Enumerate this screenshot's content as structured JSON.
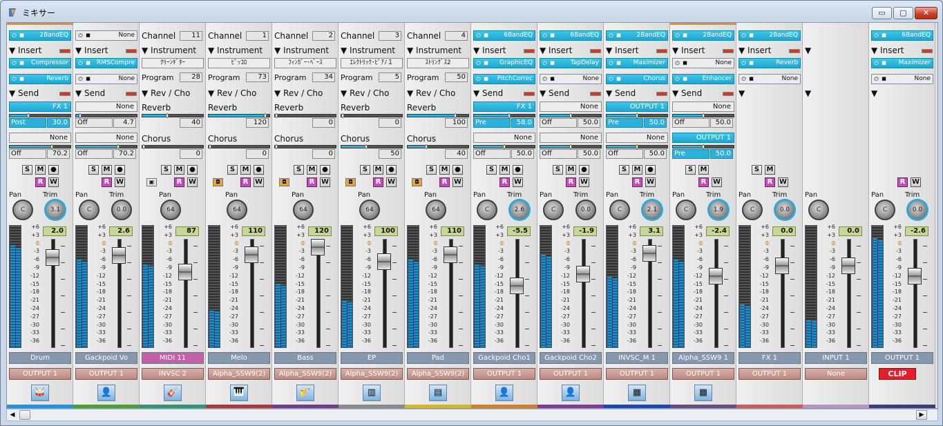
{
  "window": {
    "title": "ミキサー",
    "minimize": "▭",
    "maximize": "▢",
    "close": "✕"
  },
  "labels": {
    "insert": "Insert",
    "send": "Send",
    "channel": "Channel",
    "instrument": "Instrument",
    "program": "Program",
    "revcho": "Rev / Cho",
    "reverb": "Reverb",
    "chorus": "Chorus",
    "pan": "Pan",
    "trim": "Trim",
    "s": "S",
    "m": "M",
    "r": "R",
    "w": "W"
  },
  "scale": [
    "+6",
    "+3",
    "0",
    "-3",
    "-6",
    "-9",
    "-12",
    "-15",
    "-18",
    "-21",
    "-24",
    "-27",
    "-30",
    "-33",
    "-36"
  ],
  "scrollbar": {
    "left_arrow": "◀",
    "right_arrow": "▶"
  },
  "strips": [
    {
      "type": "audio",
      "top_color": "#e08b3a",
      "eq": "2BandEQ",
      "eq_on": true,
      "ins1": "Compressor",
      "ins1_on": true,
      "ins2": "Reverb",
      "ins2_on": true,
      "send1": "FX 1",
      "send1_on": true,
      "send1_mode": "Post",
      "send1_mode_on": true,
      "send1_val": "30.0",
      "send1_level": 0.3,
      "send2": "None",
      "send2_on": false,
      "send2_mode": "Off",
      "send2_mode_on": false,
      "send2_val": "70.2",
      "send2_level": 0.7,
      "pan": "C",
      "trim": "3.1",
      "trim_on": true,
      "level": "2.0",
      "fader": 0.82,
      "meter": 0.84,
      "name": "Drum",
      "name_color": "#8797ae",
      "output": "OUTPUT 1",
      "icon": "drums-icon",
      "glyph": "🥁",
      "color": "#2f8fd0",
      "rec": true
    },
    {
      "type": "audio",
      "top_color": "",
      "eq": "None",
      "eq_on": false,
      "ins1": "RMSCompre",
      "ins1_on": true,
      "ins2": "None",
      "ins2_on": false,
      "send1": "None",
      "send1_on": false,
      "send1_mode": "Off",
      "send1_mode_on": false,
      "send1_val": "4.7",
      "send1_level": 0.05,
      "send2": "None",
      "send2_on": false,
      "send2_mode": "Off",
      "send2_mode_on": false,
      "send2_val": "70.2",
      "send2_level": 0.7,
      "pan": "C",
      "trim": "0.0",
      "trim_on": false,
      "level": "2.6",
      "fader": 0.84,
      "meter": 0.72,
      "name": "Gackpoid Vo",
      "name_color": "#8797ae",
      "output": "OUTPUT 1",
      "icon": "vocal-icon",
      "glyph": "👤",
      "color": "#4d9c45",
      "rec": true
    },
    {
      "type": "midi",
      "channel": "11",
      "instrument": "ｸﾘｰﾝｷﾞﾀｰ",
      "program": "28",
      "reverb": "40",
      "reverb_level": 0.4,
      "chorus": "0",
      "chorus_level": 0.0,
      "pan": "64",
      "level": "87",
      "fader": 0.68,
      "meter": 0.68,
      "name": "MIDI 11",
      "name_color": "#c65fa7",
      "output": "INVSC 2",
      "icon": "guitar-icon",
      "glyph": "🎸",
      "color": "#3f8e73",
      "midi_icon": "▣"
    },
    {
      "type": "midi",
      "channel": "1",
      "instrument": "ﾋﾟｯｺﾛ",
      "program": "73",
      "reverb": "120",
      "reverb_level": 0.95,
      "chorus": "0",
      "chorus_level": 0.0,
      "pan": "64",
      "level": "110",
      "fader": 0.85,
      "meter": 0.3,
      "name": "Melo",
      "name_color": "#8797ae",
      "output": "Alpha_SSW9(2)",
      "icon": "piano-icon",
      "glyph": "🎹",
      "color": "#9f3e3e",
      "midi_icon": "◘"
    },
    {
      "type": "midi",
      "channel": "2",
      "instrument": "ﾌｨﾝｶﾞｰ･ﾍﾞｰｽ",
      "program": "34",
      "reverb": "0",
      "reverb_level": 0.0,
      "chorus": "0",
      "chorus_level": 0.0,
      "pan": "64",
      "level": "120",
      "fader": 0.92,
      "meter": 0.52,
      "name": "Bass",
      "name_color": "#8797ae",
      "output": "Alpha_SSW9(2)",
      "icon": "bass-icon",
      "glyph": "🎷",
      "color": "#6d3f88",
      "midi_icon": "◘"
    },
    {
      "type": "midi",
      "channel": "3",
      "instrument": "ｴﾚｸﾄﾘｯｸ･ﾋﾟｱﾉ１",
      "program": "5",
      "reverb": "0",
      "reverb_level": 0.0,
      "chorus": "50",
      "chorus_level": 0.4,
      "pan": "64",
      "level": "100",
      "fader": 0.78,
      "meter": 0.38,
      "name": "EP",
      "name_color": "#8797ae",
      "output": "Alpha_SSW9(2)",
      "icon": "organ-icon",
      "glyph": "▥",
      "color": "#8a8a8a",
      "midi_icon": "◘"
    },
    {
      "type": "midi",
      "channel": "4",
      "instrument": "ｽﾄﾘﾝｸﾞｽ2",
      "program": "50",
      "reverb": "100",
      "reverb_level": 0.8,
      "chorus": "40",
      "chorus_level": 0.3,
      "pan": "64",
      "level": "110",
      "fader": 0.85,
      "meter": 0.72,
      "name": "Pad",
      "name_color": "#8797ae",
      "output": "Alpha_SSW9(2)",
      "icon": "synth-icon",
      "glyph": "▤",
      "color": "#d1b43a",
      "midi_icon": "◘"
    },
    {
      "type": "audio",
      "top_color": "",
      "eq": "6BandEQ",
      "eq_on": true,
      "ins1": "GraphicEQ",
      "ins1_on": true,
      "ins2": "PitchCorrec",
      "ins2_on": true,
      "send1": "FX 1",
      "send1_on": true,
      "send1_mode": "Pre",
      "send1_mode_on": true,
      "send1_val": "58.0",
      "send1_level": 0.58,
      "send2": "None",
      "send2_on": false,
      "send2_mode": "Off",
      "send2_mode_on": false,
      "send2_val": "50.0",
      "send2_level": 0.5,
      "pan": "C",
      "trim": "2.6",
      "trim_on": true,
      "level": "-5.5",
      "fader": 0.55,
      "meter": 0.68,
      "name": "Gackpoid Cho1",
      "name_color": "#8797ae",
      "output": "OUTPUT 1",
      "icon": "vocal-red-icon",
      "glyph": "👤",
      "color": "#c78439",
      "rec": true
    },
    {
      "type": "audio",
      "top_color": "",
      "eq": "6BandEQ",
      "eq_on": true,
      "ins1": "TapDelay",
      "ins1_on": true,
      "ins2": "None",
      "ins2_on": false,
      "send1": "None",
      "send1_on": false,
      "send1_mode": "Off",
      "send1_mode_on": false,
      "send1_val": "50.0",
      "send1_level": 0.5,
      "send2": "None",
      "send2_on": false,
      "send2_mode": "Off",
      "send2_mode_on": false,
      "send2_val": "50.0",
      "send2_level": 0.5,
      "pan": "C",
      "trim": "0.0",
      "trim_on": false,
      "level": "-1.9",
      "fader": 0.66,
      "meter": 0.76,
      "name": "Gackpoid Cho2",
      "name_color": "#8797ae",
      "output": "OUTPUT 1",
      "icon": "vocal-icon",
      "glyph": "👤",
      "color": "#7a3f8f",
      "rec": true
    },
    {
      "type": "audio",
      "top_color": "",
      "eq": "2BandEQ",
      "eq_on": true,
      "ins1": "Maximizer",
      "ins1_on": true,
      "ins2": "Chorus",
      "ins2_on": true,
      "send1": "OUTPUT 1",
      "send1_on": true,
      "send1_mode": "Pre",
      "send1_mode_on": true,
      "send1_val": "50.0",
      "send1_level": 0.5,
      "send2": "None",
      "send2_on": false,
      "send2_mode": "Off",
      "send2_mode_on": false,
      "send2_val": "50.0",
      "send2_level": 0.5,
      "pan": "C",
      "trim": "2.1",
      "trim_on": true,
      "level": "3.1",
      "fader": 0.86,
      "meter": 0.58,
      "name": "INVSC_M 1",
      "name_color": "#8797ae",
      "output": "OUTPUT 1",
      "icon": "keyboard-red-icon",
      "glyph": "▦",
      "color": "#1c4aa3",
      "rec": true
    },
    {
      "type": "audio",
      "top_color": "#e08b3a",
      "eq": "2BandEQ",
      "eq_on": true,
      "ins1": "None",
      "ins1_on": false,
      "ins2": "Enhancer",
      "ins2_on": true,
      "send1": "None",
      "send1_on": false,
      "send1_mode": "Off",
      "send1_mode_on": false,
      "send1_val": "50.0",
      "send1_level": 0.5,
      "send2": "OUTPUT 1",
      "send2_on": true,
      "send2_mode": "Pre",
      "send2_mode_on": true,
      "send2_val": "50.0",
      "send2_level": 0.5,
      "pan": "C",
      "trim": "1.9",
      "trim_on": true,
      "level": "-2.4",
      "fader": 0.64,
      "meter": 0.72,
      "name": "Alpha_SSW9 1",
      "name_color": "#8797ae",
      "output": "OUTPUT 1",
      "icon": "keyboard-icon",
      "glyph": "▦",
      "color": "#6a4a82",
      "rec": false
    },
    {
      "type": "fx",
      "eq": "2BandEQ",
      "eq_on": true,
      "ins1": "Reverb",
      "ins1_on": true,
      "ins2": "None",
      "ins2_on": false,
      "pan": "C",
      "trim": "0.0",
      "trim_on": true,
      "level": "0.0",
      "fader": 0.74,
      "meter": 0.35,
      "name": "FX 1",
      "name_color": "#8797ae",
      "output": "OUTPUT 1",
      "color": "#c2605a"
    },
    {
      "type": "input",
      "pan": "C",
      "level": "0.0",
      "fader": 0.74,
      "meter": 0.22,
      "name": "INPUT 1",
      "name_color": "#8797ae",
      "output": "None",
      "color": "#b397c0"
    },
    {
      "type": "master",
      "eq": "6BandEQ",
      "eq_on": true,
      "ins1": "Maximizer",
      "ins1_on": true,
      "ins2": "None",
      "ins2_on": false,
      "pan": "C",
      "trim": "0.0",
      "trim_on": true,
      "level": "-2.6",
      "fader": 0.64,
      "meter": 0.9,
      "name": "OUTPUT 1",
      "name_color": "#8797ae",
      "output": "CLIP",
      "color": "#3c3c78"
    }
  ]
}
